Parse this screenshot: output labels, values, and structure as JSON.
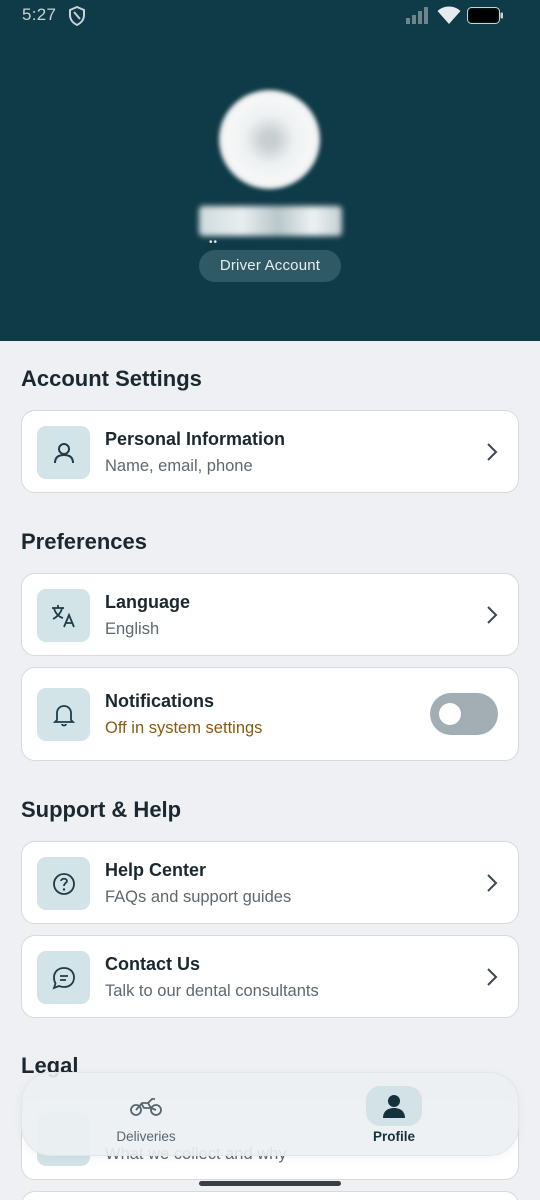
{
  "status_bar": {
    "time": "5:27"
  },
  "profile": {
    "role": "Driver Account"
  },
  "sections": {
    "account_settings": "Account Settings",
    "preferences": "Preferences",
    "support_help": "Support & Help",
    "legal": "Legal"
  },
  "items": {
    "personal_info": {
      "title": "Personal Information",
      "subtitle": "Name, email, phone",
      "icon": "user-icon"
    },
    "language": {
      "title": "Language",
      "subtitle": "English",
      "icon": "translate-icon"
    },
    "notifications": {
      "title": "Notifications",
      "subtitle": "Off in system settings",
      "icon": "bell-icon",
      "enabled": false
    },
    "help_center": {
      "title": "Help Center",
      "subtitle": "FAQs and support guides",
      "icon": "question-icon"
    },
    "contact_us": {
      "title": "Contact Us",
      "subtitle": "Talk to our dental consultants",
      "icon": "chat-icon"
    },
    "privacy": {
      "subtitle": "What we collect and why"
    }
  },
  "bottom_nav": {
    "items": [
      {
        "label": "Deliveries",
        "icon": "motorcycle-icon",
        "active": false
      },
      {
        "label": "Profile",
        "icon": "person-icon",
        "active": true
      }
    ]
  },
  "colors": {
    "header_bg": "#0f3a47",
    "accent": "#d3e4e8",
    "warning": "#8a5a0e"
  }
}
